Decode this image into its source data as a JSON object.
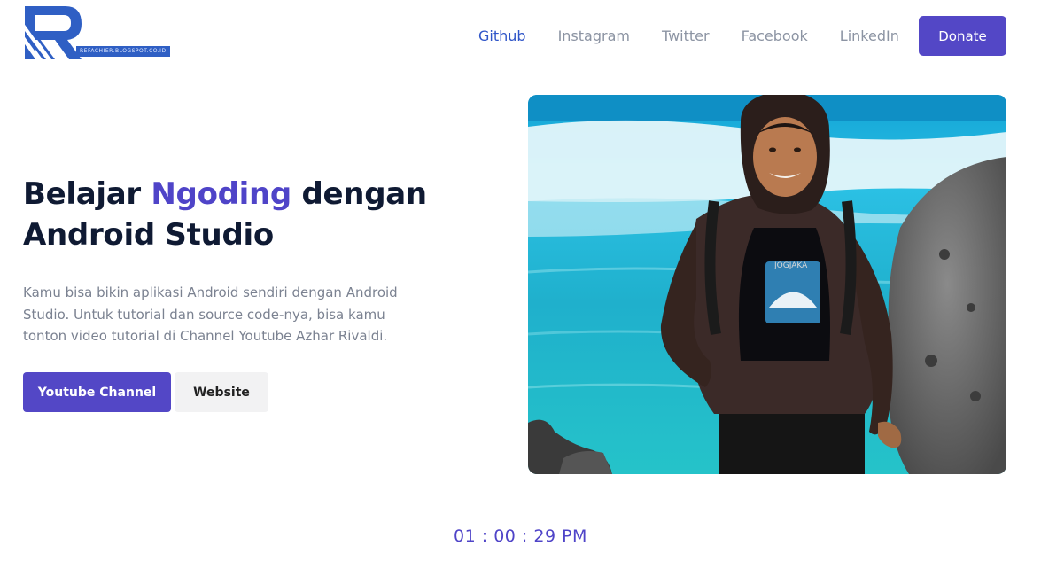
{
  "brand": {
    "logo_text": "REFACHIER.BLOGSPOT.CO.ID"
  },
  "nav": {
    "items": [
      {
        "label": "Github",
        "active": true
      },
      {
        "label": "Instagram",
        "active": false
      },
      {
        "label": "Twitter",
        "active": false
      },
      {
        "label": "Facebook",
        "active": false
      },
      {
        "label": "LinkedIn",
        "active": false
      }
    ],
    "donate_label": "Donate"
  },
  "hero": {
    "title_part1": "Belajar ",
    "title_accent": "Ngoding",
    "title_part2": " dengan Android Studio",
    "description": "Kamu bisa bikin aplikasi Android sendiri dengan Android Studio. Untuk tutorial dan source code-nya, bisa kamu tonton video tutorial di Channel Youtube Azhar Rivaldi.",
    "primary_button": "Youtube Channel",
    "secondary_button": "Website",
    "shirt_text": "JOGJAKA"
  },
  "clock": {
    "time": "01 : 00 : 29 PM"
  },
  "colors": {
    "accent": "#5347c6",
    "nav_active": "#2f55c8",
    "heading": "#0f1a33",
    "muted": "#7b8291"
  }
}
